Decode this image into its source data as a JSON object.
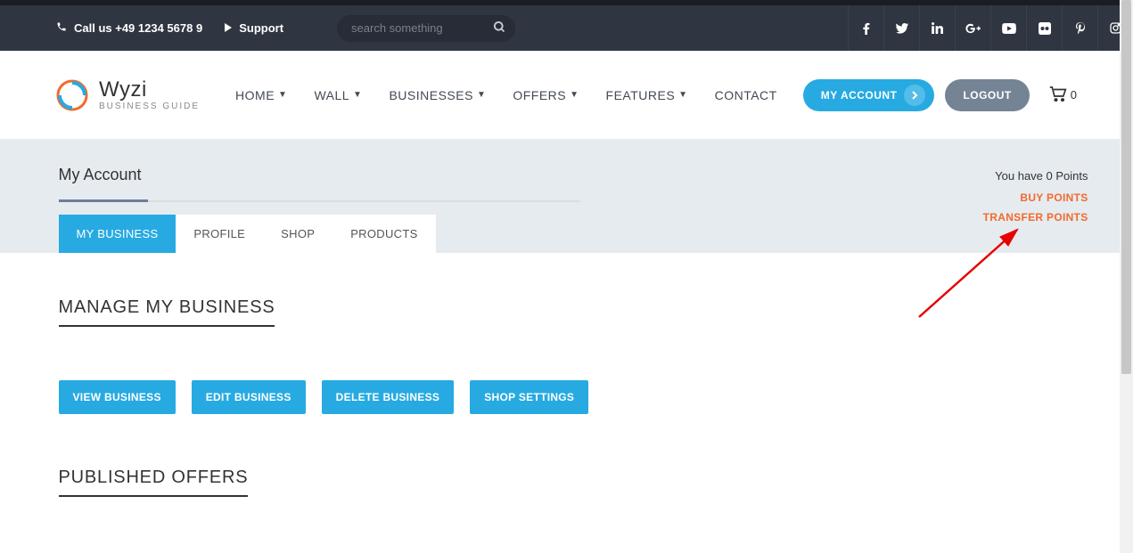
{
  "topbar": {
    "call_label": "Call us +49 1234 5678 9",
    "support_label": "Support",
    "search_placeholder": "search something"
  },
  "social": [
    "facebook",
    "twitter",
    "linkedin",
    "google-plus",
    "youtube",
    "flickr",
    "pinterest",
    "instagram"
  ],
  "brand": {
    "name": "Wyzi",
    "tagline": "BUSINESS GUIDE"
  },
  "nav": {
    "items": [
      {
        "label": "HOME",
        "dropdown": true
      },
      {
        "label": "WALL",
        "dropdown": true
      },
      {
        "label": "BUSINESSES",
        "dropdown": true
      },
      {
        "label": "OFFERS",
        "dropdown": true
      },
      {
        "label": "FEATURES",
        "dropdown": true
      },
      {
        "label": "CONTACT",
        "dropdown": false
      }
    ],
    "account_label": "MY ACCOUNT",
    "logout_label": "LOGOUT",
    "cart_count": "0"
  },
  "page": {
    "title": "My Account",
    "points_text": "You have 0 Points",
    "buy_points_label": "BUY POINTS",
    "transfer_points_label": "TRANSFER POINTS",
    "tabs": [
      {
        "label": "MY BUSINESS",
        "active": true
      },
      {
        "label": "PROFILE",
        "active": false
      },
      {
        "label": "SHOP",
        "active": false
      },
      {
        "label": "PRODUCTS",
        "active": false
      }
    ]
  },
  "sections": {
    "manage_title": "MANAGE MY BUSINESS",
    "buttons": [
      {
        "label": "VIEW BUSINESS"
      },
      {
        "label": "EDIT BUSINESS"
      },
      {
        "label": "DELETE BUSINESS"
      },
      {
        "label": "SHOP SETTINGS"
      }
    ],
    "published_title": "PUBLISHED OFFERS"
  },
  "colors": {
    "accent": "#27aae1",
    "orange": "#f26a2c",
    "topbar": "#2f3541",
    "pagehead": "#e6ebf0"
  }
}
